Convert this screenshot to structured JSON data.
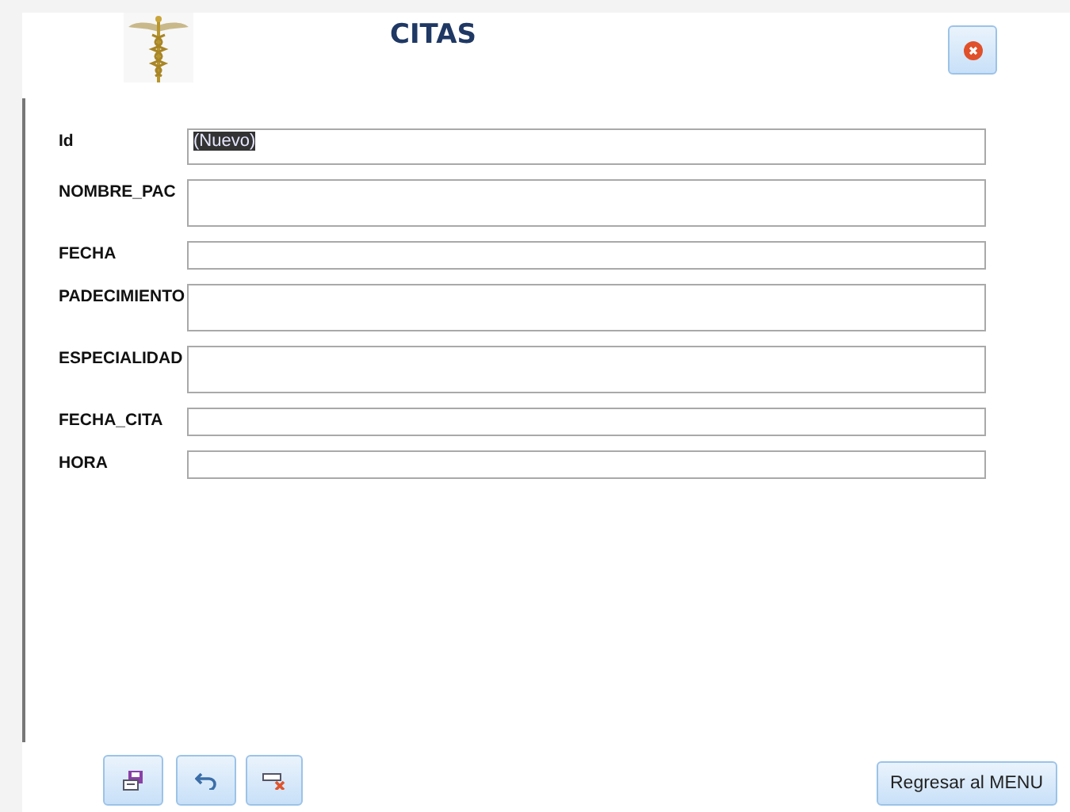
{
  "form": {
    "title": "CITAS"
  },
  "fields": [
    {
      "label": "Id",
      "kind": "short",
      "value": "(Nuevo)",
      "value_selected": true
    },
    {
      "label": "NOMBRE_PAC",
      "kind": "tall"
    },
    {
      "label": "FECHA",
      "kind": "thin"
    },
    {
      "label": "PADECIMIENTO",
      "kind": "tall"
    },
    {
      "label": "ESPECIALIDAD",
      "kind": "tall"
    },
    {
      "label": "FECHA_CITA",
      "kind": "thin"
    },
    {
      "label": "HORA",
      "kind": "thin"
    }
  ],
  "toolbar": [
    {
      "kind": "save"
    },
    {
      "kind": "undo"
    },
    {
      "kind": "delete"
    }
  ],
  "menu_button": "Regresar al MENU"
}
